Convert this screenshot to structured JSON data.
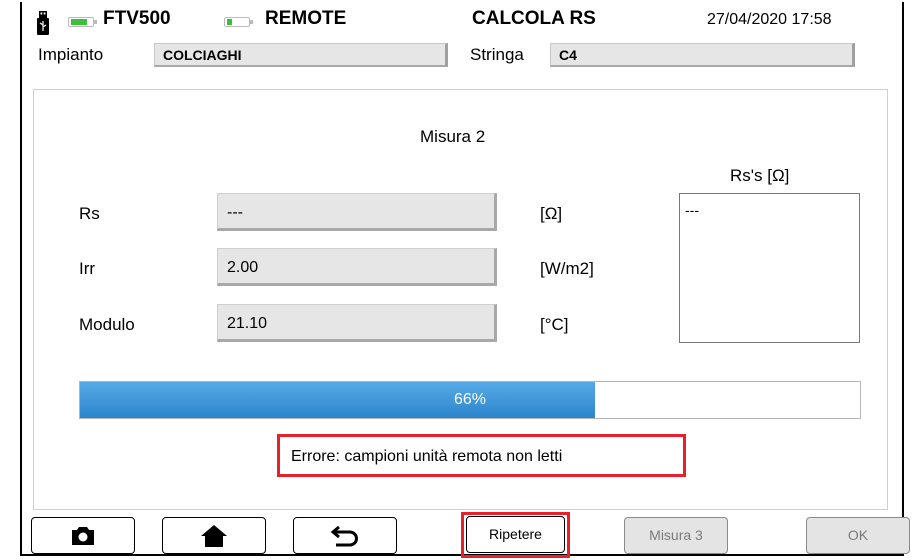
{
  "status_bar": {
    "device": "FTV500",
    "remote": "REMOTE",
    "screen_title": "CALCOLA RS",
    "datetime": "27/04/2020 17:58"
  },
  "header": {
    "plant_label": "Impianto",
    "plant_value": "COLCIAGHI",
    "string_label": "Stringa",
    "string_value": "C4"
  },
  "main": {
    "measure_title": "Misura 2",
    "rs_list_title": "Rs's [Ω]",
    "rs_list_items": [
      "---"
    ],
    "rows": [
      {
        "label": "Rs",
        "value": "---",
        "unit": "[Ω]"
      },
      {
        "label": "Irr",
        "value": "2.00",
        "unit": "[W/m2]"
      },
      {
        "label": "Modulo",
        "value": "21.10",
        "unit": "[°C]"
      }
    ],
    "progress": {
      "text": "66%",
      "fraction": 0.66
    },
    "error_message": "Errore: campioni unità remota non letti"
  },
  "toolbar": {
    "camera_icon": "camera-icon",
    "home_icon": "home-icon",
    "back_icon": "back-arrow-icon",
    "repeat_label": "Ripetere",
    "next_label": "Misura 3",
    "ok_label": "OK"
  },
  "colors": {
    "accent_blue": "#2c86cc",
    "error_red": "#e8202c",
    "battery_green": "#3cc03c"
  }
}
